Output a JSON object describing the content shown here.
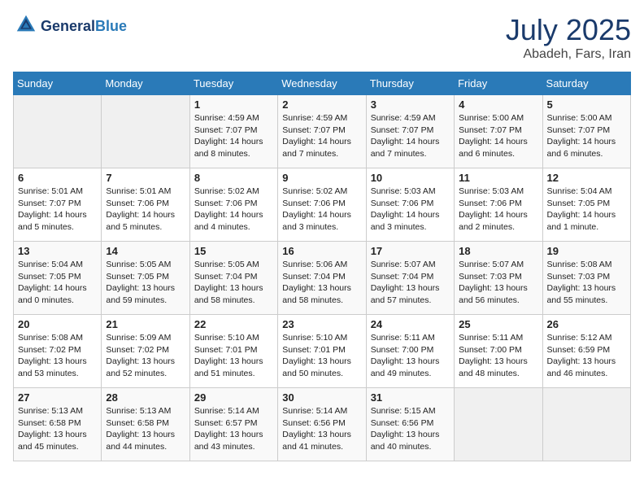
{
  "header": {
    "logo_line1": "General",
    "logo_line2": "Blue",
    "month": "July 2025",
    "location": "Abadeh, Fars, Iran"
  },
  "weekdays": [
    "Sunday",
    "Monday",
    "Tuesday",
    "Wednesday",
    "Thursday",
    "Friday",
    "Saturday"
  ],
  "weeks": [
    [
      {
        "day": "",
        "info": ""
      },
      {
        "day": "",
        "info": ""
      },
      {
        "day": "1",
        "info": "Sunrise: 4:59 AM\nSunset: 7:07 PM\nDaylight: 14 hours and 8 minutes."
      },
      {
        "day": "2",
        "info": "Sunrise: 4:59 AM\nSunset: 7:07 PM\nDaylight: 14 hours and 7 minutes."
      },
      {
        "day": "3",
        "info": "Sunrise: 4:59 AM\nSunset: 7:07 PM\nDaylight: 14 hours and 7 minutes."
      },
      {
        "day": "4",
        "info": "Sunrise: 5:00 AM\nSunset: 7:07 PM\nDaylight: 14 hours and 6 minutes."
      },
      {
        "day": "5",
        "info": "Sunrise: 5:00 AM\nSunset: 7:07 PM\nDaylight: 14 hours and 6 minutes."
      }
    ],
    [
      {
        "day": "6",
        "info": "Sunrise: 5:01 AM\nSunset: 7:07 PM\nDaylight: 14 hours and 5 minutes."
      },
      {
        "day": "7",
        "info": "Sunrise: 5:01 AM\nSunset: 7:06 PM\nDaylight: 14 hours and 5 minutes."
      },
      {
        "day": "8",
        "info": "Sunrise: 5:02 AM\nSunset: 7:06 PM\nDaylight: 14 hours and 4 minutes."
      },
      {
        "day": "9",
        "info": "Sunrise: 5:02 AM\nSunset: 7:06 PM\nDaylight: 14 hours and 3 minutes."
      },
      {
        "day": "10",
        "info": "Sunrise: 5:03 AM\nSunset: 7:06 PM\nDaylight: 14 hours and 3 minutes."
      },
      {
        "day": "11",
        "info": "Sunrise: 5:03 AM\nSunset: 7:06 PM\nDaylight: 14 hours and 2 minutes."
      },
      {
        "day": "12",
        "info": "Sunrise: 5:04 AM\nSunset: 7:05 PM\nDaylight: 14 hours and 1 minute."
      }
    ],
    [
      {
        "day": "13",
        "info": "Sunrise: 5:04 AM\nSunset: 7:05 PM\nDaylight: 14 hours and 0 minutes."
      },
      {
        "day": "14",
        "info": "Sunrise: 5:05 AM\nSunset: 7:05 PM\nDaylight: 13 hours and 59 minutes."
      },
      {
        "day": "15",
        "info": "Sunrise: 5:05 AM\nSunset: 7:04 PM\nDaylight: 13 hours and 58 minutes."
      },
      {
        "day": "16",
        "info": "Sunrise: 5:06 AM\nSunset: 7:04 PM\nDaylight: 13 hours and 58 minutes."
      },
      {
        "day": "17",
        "info": "Sunrise: 5:07 AM\nSunset: 7:04 PM\nDaylight: 13 hours and 57 minutes."
      },
      {
        "day": "18",
        "info": "Sunrise: 5:07 AM\nSunset: 7:03 PM\nDaylight: 13 hours and 56 minutes."
      },
      {
        "day": "19",
        "info": "Sunrise: 5:08 AM\nSunset: 7:03 PM\nDaylight: 13 hours and 55 minutes."
      }
    ],
    [
      {
        "day": "20",
        "info": "Sunrise: 5:08 AM\nSunset: 7:02 PM\nDaylight: 13 hours and 53 minutes."
      },
      {
        "day": "21",
        "info": "Sunrise: 5:09 AM\nSunset: 7:02 PM\nDaylight: 13 hours and 52 minutes."
      },
      {
        "day": "22",
        "info": "Sunrise: 5:10 AM\nSunset: 7:01 PM\nDaylight: 13 hours and 51 minutes."
      },
      {
        "day": "23",
        "info": "Sunrise: 5:10 AM\nSunset: 7:01 PM\nDaylight: 13 hours and 50 minutes."
      },
      {
        "day": "24",
        "info": "Sunrise: 5:11 AM\nSunset: 7:00 PM\nDaylight: 13 hours and 49 minutes."
      },
      {
        "day": "25",
        "info": "Sunrise: 5:11 AM\nSunset: 7:00 PM\nDaylight: 13 hours and 48 minutes."
      },
      {
        "day": "26",
        "info": "Sunrise: 5:12 AM\nSunset: 6:59 PM\nDaylight: 13 hours and 46 minutes."
      }
    ],
    [
      {
        "day": "27",
        "info": "Sunrise: 5:13 AM\nSunset: 6:58 PM\nDaylight: 13 hours and 45 minutes."
      },
      {
        "day": "28",
        "info": "Sunrise: 5:13 AM\nSunset: 6:58 PM\nDaylight: 13 hours and 44 minutes."
      },
      {
        "day": "29",
        "info": "Sunrise: 5:14 AM\nSunset: 6:57 PM\nDaylight: 13 hours and 43 minutes."
      },
      {
        "day": "30",
        "info": "Sunrise: 5:14 AM\nSunset: 6:56 PM\nDaylight: 13 hours and 41 minutes."
      },
      {
        "day": "31",
        "info": "Sunrise: 5:15 AM\nSunset: 6:56 PM\nDaylight: 13 hours and 40 minutes."
      },
      {
        "day": "",
        "info": ""
      },
      {
        "day": "",
        "info": ""
      }
    ]
  ]
}
